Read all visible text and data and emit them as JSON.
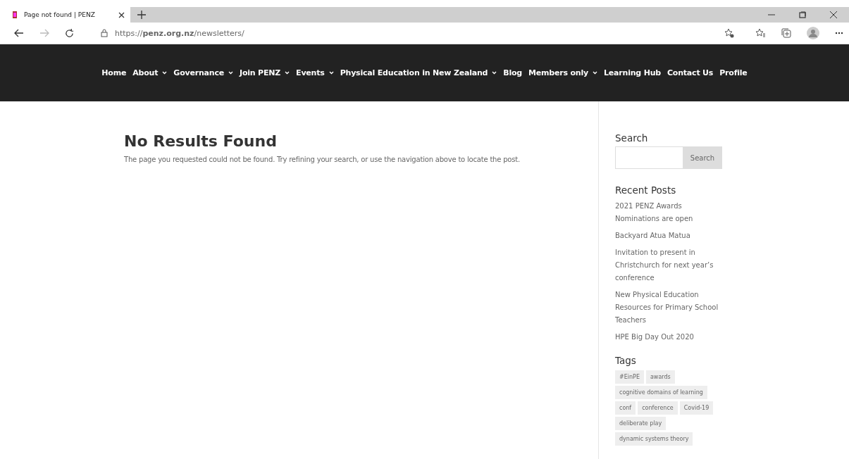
{
  "browser": {
    "tab_title": "Page not found | PENZ",
    "url": "https://**penz.org.nz**/newsletters/"
  },
  "nav": [
    {
      "label": "Home",
      "dropdown": false
    },
    {
      "label": "About",
      "dropdown": true
    },
    {
      "label": "Governance",
      "dropdown": true
    },
    {
      "label": "Join PENZ",
      "dropdown": true
    },
    {
      "label": "Events",
      "dropdown": true
    },
    {
      "label": "Physical Education in New Zealand",
      "dropdown": true
    },
    {
      "label": "Blog",
      "dropdown": false
    },
    {
      "label": "Members only",
      "dropdown": true
    },
    {
      "label": "Learning Hub",
      "dropdown": false
    },
    {
      "label": "Contact Us",
      "dropdown": false
    },
    {
      "label": "Profile",
      "dropdown": false
    }
  ],
  "main": {
    "title": "No Results Found",
    "message": "The page you requested could not be found. Try refining your search, or use the navigation above to locate the post."
  },
  "sidebar": {
    "search_title": "Search",
    "search_button": "Search",
    "recent_title": "Recent Posts",
    "recent_posts": [
      "2021 PENZ Awards Nominations are open",
      "Backyard Atua Matua",
      "Invitation to present in Christchurch for next year’s conference",
      "New Physical Education Resources for Primary School Teachers",
      "HPE Big Day Out 2020"
    ],
    "tags_title": "Tags",
    "tags": [
      [
        "#EinPE",
        "awards"
      ],
      [
        "cognitive domains of learning"
      ],
      [
        "conf",
        "conference",
        "Covid-19"
      ],
      [
        "deliberate play"
      ],
      [
        "dynamic systems theory"
      ]
    ]
  }
}
